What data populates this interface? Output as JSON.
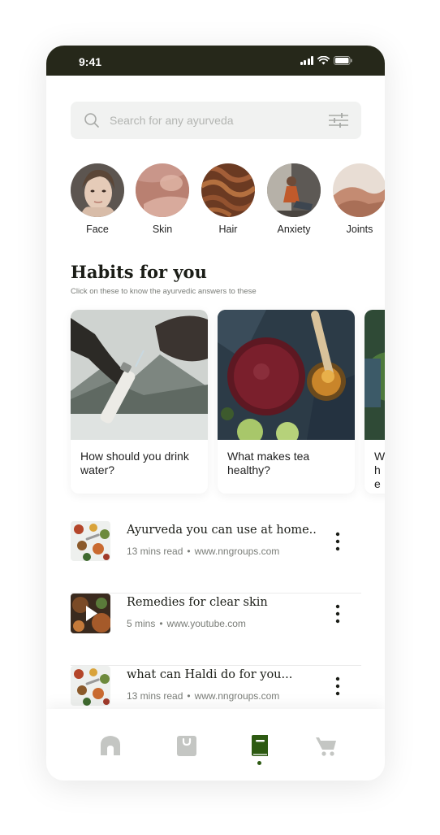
{
  "status_bar": {
    "time": "9:41"
  },
  "search": {
    "placeholder": "Search for any ayurveda"
  },
  "categories": [
    {
      "label": "Face"
    },
    {
      "label": "Skin"
    },
    {
      "label": "Hair"
    },
    {
      "label": "Anxiety"
    },
    {
      "label": "Joints"
    }
  ],
  "habits": {
    "title": "Habits for you",
    "subtitle": "Click on these to know the ayurvedic answers to these",
    "cards": [
      {
        "title": "How should you drink water?"
      },
      {
        "title": "What makes tea healthy?"
      },
      {
        "title": "W he"
      }
    ]
  },
  "articles": [
    {
      "title": "Ayurveda you can use at home..",
      "duration": "13 mins read",
      "source": "www.nngroups.com",
      "type": "article"
    },
    {
      "title": "Remedies for clear skin",
      "duration": "5 mins",
      "source": "www.youtube.com",
      "type": "video"
    },
    {
      "title": "what can Haldi do for you...",
      "duration": "13 mins read",
      "source": "www.nngroups.com",
      "type": "article"
    }
  ],
  "nav": {
    "items": [
      {
        "icon": "home-icon",
        "active": false
      },
      {
        "icon": "bag-icon",
        "active": false
      },
      {
        "icon": "book-icon",
        "active": true
      },
      {
        "icon": "cart-icon",
        "active": false
      }
    ]
  },
  "colors": {
    "status_bar_bg": "#26281a",
    "accent": "#2d5a12",
    "inactive_icon": "#c4c6c3",
    "search_bg": "#f1f2f1"
  }
}
